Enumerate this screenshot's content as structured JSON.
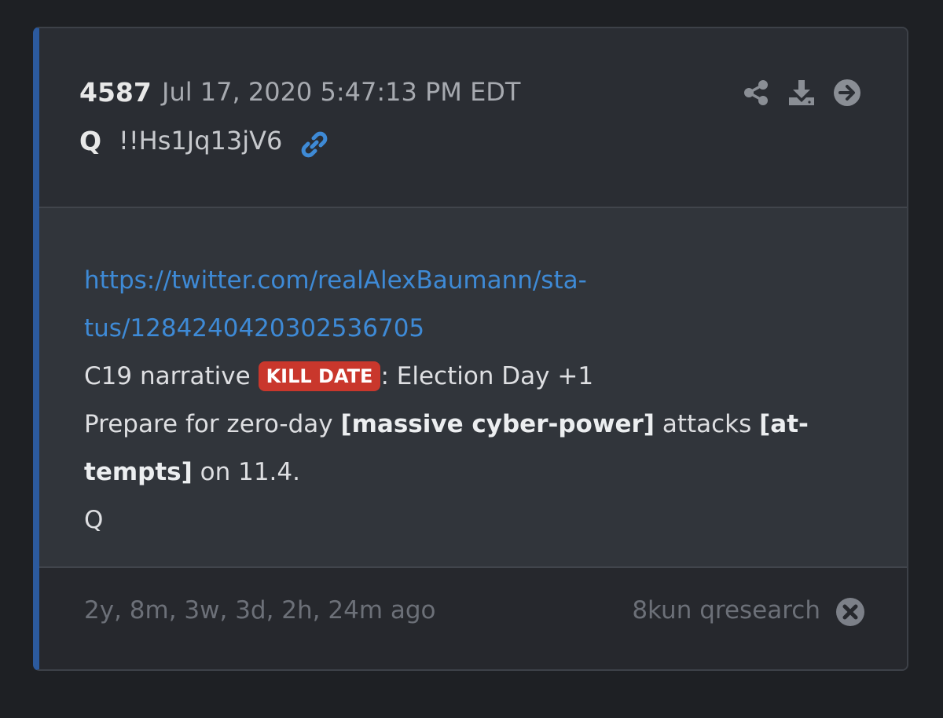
{
  "post": {
    "number": "4587",
    "date": "Jul 17, 2020 5:47:13 PM EDT",
    "author": "Q",
    "tripcode": "!!Hs1Jq13jV6"
  },
  "body": {
    "link_line1": "https://twitter.com/realAlexBaumann/sta-",
    "link_line2": "tus/1284240420302536705",
    "line3_prefix": "C19 narrative ",
    "badge": "KILL DATE",
    "line3_suffix": ": Election Day +1",
    "line4_prefix": "Prepare for zero-day ",
    "line4_bold1": "[massive cyber-power]",
    "line4_mid": " attacks ",
    "line4_bold2": "[at-",
    "line5_bold": "tempts]",
    "line5_suffix": " on 11.4.",
    "signature": "Q"
  },
  "footer": {
    "age": "2y, 8m, 3w, 3d, 2h, 24m ago",
    "source": "8kun qresearch"
  },
  "icons": {
    "header": [
      "share-icon",
      "download-icon",
      "arrow-right-circle-icon"
    ],
    "author_link": "link-icon",
    "footer": "close-circle-icon"
  },
  "colors": {
    "accent_border": "#2c5a9e",
    "link": "#3e8ad6",
    "badge": "#c9372c"
  }
}
